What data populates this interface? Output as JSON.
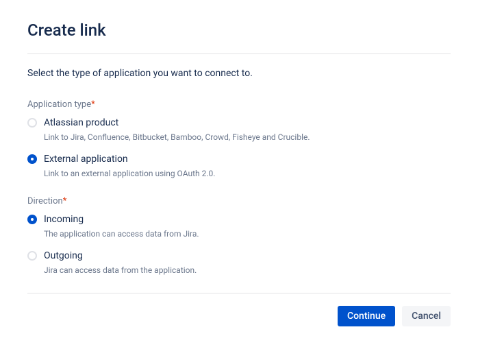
{
  "header": {
    "title": "Create link"
  },
  "instruction": "Select the type of application you want to connect to.",
  "sections": {
    "app_type": {
      "label": "Application type",
      "required_mark": "*",
      "options": {
        "atlassian": {
          "label": "Atlassian product",
          "description": "Link to Jira, Confluence, Bitbucket, Bamboo, Crowd, Fisheye and Crucible."
        },
        "external": {
          "label": "External application",
          "description": "Link to an external application using OAuth 2.0."
        }
      }
    },
    "direction": {
      "label": "Direction",
      "required_mark": "*",
      "options": {
        "incoming": {
          "label": "Incoming",
          "description": "The application can access data from Jira."
        },
        "outgoing": {
          "label": "Outgoing",
          "description": "Jira can access data from the application."
        }
      }
    }
  },
  "footer": {
    "continue_label": "Continue",
    "cancel_label": "Cancel"
  }
}
